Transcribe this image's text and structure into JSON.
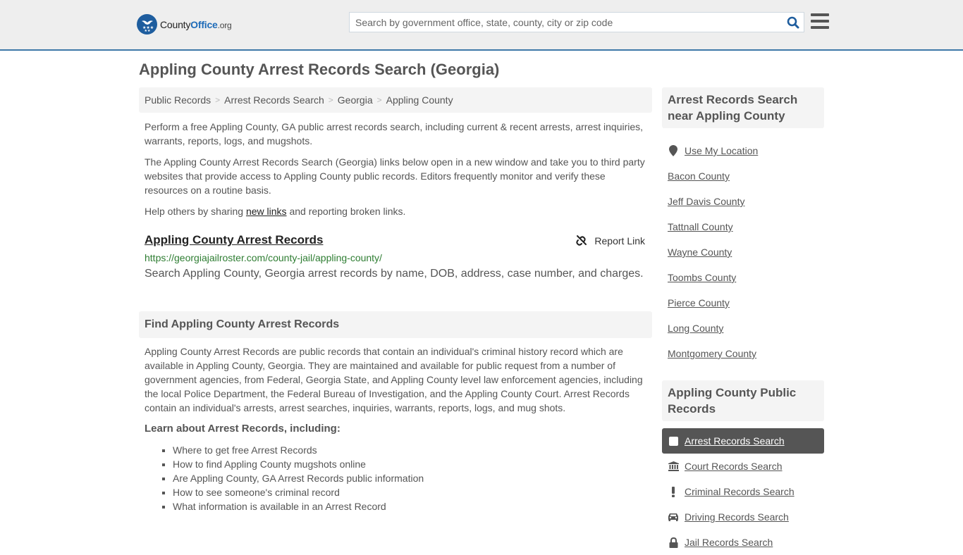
{
  "header": {
    "logo": {
      "prefix": "County",
      "office": "Office",
      "suffix": ".org"
    },
    "search": {
      "placeholder": "Search by government office, state, county, city or zip code",
      "value": ""
    },
    "icons": {
      "search": "search-icon",
      "menu": "hamburger-menu-icon"
    }
  },
  "page": {
    "title": "Appling County Arrest Records Search (Georgia)"
  },
  "breadcrumb": [
    {
      "label": "Public Records"
    },
    {
      "label": "Arrest Records Search"
    },
    {
      "label": "Georgia"
    },
    {
      "label": "Appling County"
    }
  ],
  "intro": {
    "p1": "Perform a free Appling County, GA public arrest records search, including current & recent arrests, arrest inquiries, warrants, reports, logs, and mugshots.",
    "p2": "The Appling County Arrest Records Search (Georgia) links below open in a new window and take you to third party websites that provide access to Appling County public records. Editors frequently monitor and verify these resources on a routine basis.",
    "p3_before": "Help others by sharing ",
    "p3_link": "new links",
    "p3_after": " and reporting broken links."
  },
  "results": [
    {
      "title": "Appling County Arrest Records",
      "url": "https://georgiajailroster.com/county-jail/appling-county/",
      "description": "Search Appling County, Georgia arrest records by name, DOB, address, case number, and charges.",
      "report_label": "Report Link"
    }
  ],
  "find_section": {
    "heading": "Find Appling County Arrest Records",
    "body": "Appling County Arrest Records are public records that contain an individual's criminal history record which are available in Appling County, Georgia. They are maintained and available for public request from a number of government agencies, from Federal, Georgia State, and Appling County level law enforcement agencies, including the local Police Department, the Federal Bureau of Investigation, and the Appling County Court. Arrest Records contain an individual's arrests, arrest searches, inquiries, warrants, reports, logs, and mug shots.",
    "learn_title": "Learn about Arrest Records, including:",
    "learn_items": [
      "Where to get free Arrest Records",
      "How to find Appling County mugshots online",
      "Are Appling County, GA Arrest Records public information",
      "How to see someone's criminal record",
      "What information is available in an Arrest Record"
    ]
  },
  "sidebar": {
    "nearby_heading": "Arrest Records Search near Appling County",
    "use_location": "Use My Location",
    "nearby": [
      "Bacon County",
      "Jeff Davis County",
      "Tattnall County",
      "Wayne County",
      "Toombs County",
      "Pierce County",
      "Long County",
      "Montgomery County"
    ],
    "records_heading": "Appling County Public Records",
    "records": [
      {
        "label": "Arrest Records Search",
        "icon": "square-icon",
        "active": true
      },
      {
        "label": "Court Records Search",
        "icon": "courthouse-icon",
        "active": false
      },
      {
        "label": "Criminal Records Search",
        "icon": "exclamation-icon",
        "active": false
      },
      {
        "label": "Driving Records Search",
        "icon": "car-icon",
        "active": false
      },
      {
        "label": "Jail Records Search",
        "icon": "lock-icon",
        "active": false
      }
    ]
  },
  "colors": {
    "accent": "#3e78a8",
    "brand_blue": "#1e6bb8",
    "url_green": "#2e7d32",
    "active_bg": "#555555",
    "panel_bg": "#f4f4f4"
  }
}
